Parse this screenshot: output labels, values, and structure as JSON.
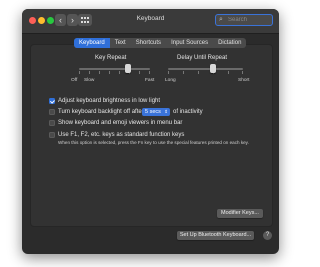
{
  "window": {
    "title": "Keyboard"
  },
  "toolbar": {
    "back_icon": "chevron-left-icon",
    "forward_icon": "chevron-right-icon",
    "grid_icon": "show-all-grid-icon",
    "search_placeholder": "Search",
    "search_value": ""
  },
  "tabs": [
    {
      "label": "Keyboard",
      "active": true
    },
    {
      "label": "Text",
      "active": false
    },
    {
      "label": "Shortcuts",
      "active": false
    },
    {
      "label": "Input Sources",
      "active": false
    },
    {
      "label": "Dictation",
      "active": false
    }
  ],
  "key_repeat": {
    "label": "Key Repeat",
    "min_label": "Off",
    "slow_label": "Slow",
    "max_label": "Fast",
    "value_fraction": 0.69
  },
  "delay_until_repeat": {
    "label": "Delay Until Repeat",
    "min_label": "Long",
    "max_label": "Short",
    "value_fraction": 0.6
  },
  "options": {
    "adjust_brightness": {
      "label": "Adjust keyboard brightness in low light",
      "checked": true
    },
    "backlight_off": {
      "label_before": "Turn keyboard backlight off after",
      "select_value": "5 secs",
      "label_after": "of inactivity",
      "checked": false
    },
    "show_viewers": {
      "label": "Show keyboard and emoji viewers in menu bar",
      "checked": false
    },
    "function_keys": {
      "label": "Use F1, F2, etc. keys as standard function keys",
      "note": "When this option is selected, press the Fn key to use the special features printed on each key.",
      "checked": false
    }
  },
  "buttons": {
    "modifier_keys": "Modifier Keys...",
    "bluetooth": "Set Up Bluetooth Keyboard...",
    "help": "?"
  },
  "colors": {
    "accent": "#2f6fd9",
    "window_bg": "#2b2b2b",
    "panel_bg": "#323232"
  }
}
